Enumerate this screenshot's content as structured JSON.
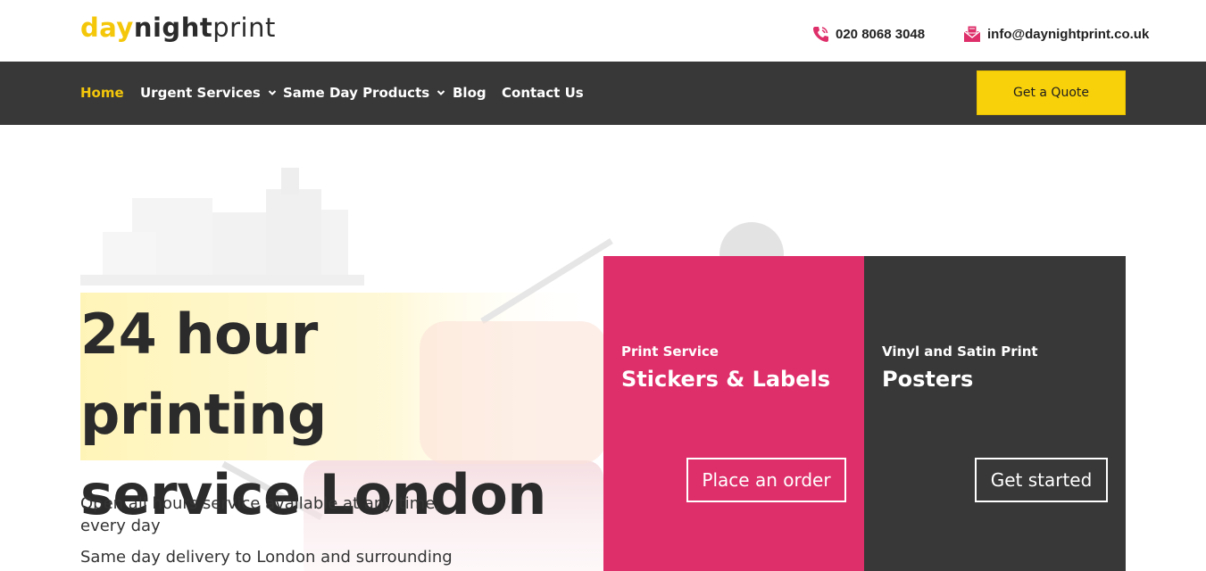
{
  "header": {
    "logo": {
      "day": "day",
      "night": "night",
      "print": "print"
    },
    "phone": "020 8068 3048",
    "email": "info@daynightprint.co.uk",
    "icons": {
      "phone": "phone-icon",
      "email": "email-icon"
    }
  },
  "nav": {
    "items": [
      {
        "label": "Home",
        "active": true,
        "dropdown": false
      },
      {
        "label": "Urgent Services",
        "active": false,
        "dropdown": true
      },
      {
        "label": "Same Day Products",
        "active": false,
        "dropdown": true
      },
      {
        "label": "Blog",
        "active": false,
        "dropdown": false
      },
      {
        "label": "Contact Us",
        "active": false,
        "dropdown": false
      }
    ],
    "quote_button": "Get a Quote"
  },
  "hero": {
    "title_line1": "24 hour printing",
    "title_line2": "service London",
    "desc1": "Open all hours service available at any time, every day",
    "desc2": "Same day delivery to London and surrounding"
  },
  "cards": [
    {
      "eyebrow": "Print Service",
      "title": "Stickers & Labels",
      "button": "Place an order"
    },
    {
      "eyebrow": "Vinyl and Satin Print",
      "title": "Posters",
      "button": "Get started"
    }
  ],
  "colors": {
    "accent_yellow": "#f4c70b",
    "nav_bg": "#383838",
    "pink": "#de2f6a",
    "dark": "#383838"
  }
}
